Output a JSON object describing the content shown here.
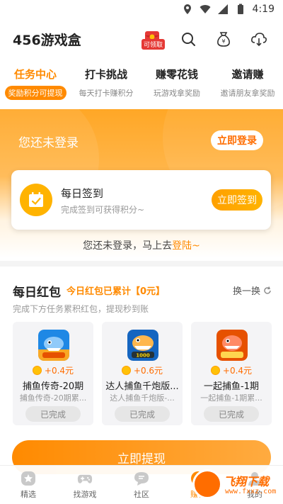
{
  "statusbar": {
    "time": "4:19"
  },
  "header": {
    "title": "456游戏盒",
    "claim_badge": "可领取"
  },
  "tabs": [
    {
      "title": "任务中心",
      "subtitle": "奖励积分可提现",
      "active": true
    },
    {
      "title": "打卡挑战",
      "subtitle": "每天打卡赚积分"
    },
    {
      "title": "赚零花钱",
      "subtitle": "玩游戏拿奖励"
    },
    {
      "title": "邀请赚",
      "subtitle": "邀请朋友拿奖励"
    }
  ],
  "banner": {
    "not_logged_in": "您还未登录",
    "login_button": "立即登录"
  },
  "signin": {
    "title": "每日签到",
    "subtitle": "完成签到可获得积分~",
    "button": "立即签到"
  },
  "login_hint": {
    "text": "您还未登录，马上去",
    "link": "登陆~"
  },
  "redpack": {
    "title": "每日红包",
    "total": "今日红包已累计【0元】",
    "refresh": "换一换",
    "description": "完成下方任务累积红包，提现秒到账",
    "games": [
      {
        "reward": "+0.4元",
        "name": "捕鱼传奇-20期",
        "sub": "捕鱼传奇-20期累...",
        "status": "已完成"
      },
      {
        "reward": "+0.6元",
        "name": "达人捕鱼千炮版...",
        "sub": "达人捕鱼千炮版-...",
        "status": "已完成"
      },
      {
        "reward": "+0.4元",
        "name": "一起捕鱼-1期",
        "sub": "一起捕鱼-1期累...",
        "status": "已完成"
      }
    ]
  },
  "withdraw_button": "立即提现",
  "bottom_nav": [
    {
      "label": "精选",
      "icon": "star-icon"
    },
    {
      "label": "找游戏",
      "icon": "gamepad-icon"
    },
    {
      "label": "社区",
      "icon": "chat-icon"
    },
    {
      "label": "赚钱",
      "icon": "money-icon",
      "active": true
    },
    {
      "label": "我的",
      "icon": "user-icon"
    }
  ],
  "watermark": {
    "text": "飞翔下载",
    "url": "www.fxxz.com"
  },
  "colors": {
    "accent": "#ff8a00",
    "banner": "#ffa726",
    "coin": "#ffc107"
  }
}
